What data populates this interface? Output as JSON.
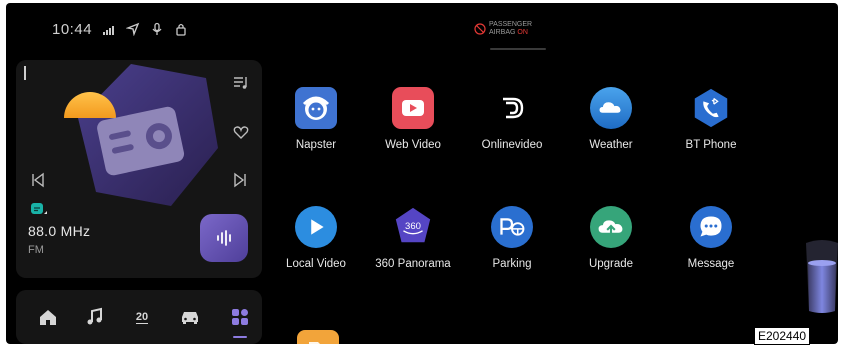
{
  "status_bar": {
    "time": "10:44",
    "icons": [
      "signal-icon",
      "navigation-icon",
      "microphone-icon",
      "lock-icon"
    ]
  },
  "airbag_indicator": {
    "line1": "PASSENGER",
    "line2_prefix": "AIRBAG",
    "line2_state": "ON",
    "state_color": "#e53935"
  },
  "media": {
    "frequency": "88.0 MHz",
    "band": "FM",
    "controls": [
      "playlist-icon",
      "favorite-icon",
      "previous-icon",
      "next-icon",
      "voice-wave-icon"
    ]
  },
  "dock": {
    "items": [
      "home-icon",
      "music-icon",
      "climate-temp",
      "car-icon",
      "apps-grid-icon"
    ],
    "temp": "20",
    "active_color": "#8d7be0"
  },
  "apps": [
    {
      "label": "Napster",
      "icon": "napster-icon",
      "color": "#3f73d1"
    },
    {
      "label": "Web Video",
      "icon": "web-video-icon",
      "color": "#e84d5a"
    },
    {
      "label": "Onlinevideo",
      "icon": "onlinevideo-icon",
      "color": "#000000"
    },
    {
      "label": "Weather",
      "icon": "weather-icon",
      "color": "#2f82d8"
    },
    {
      "label": "BT Phone",
      "icon": "bt-phone-icon",
      "color": "#2a6ed0"
    },
    {
      "label": "Local Video",
      "icon": "local-video-icon",
      "color": "#2c8de0"
    },
    {
      "label": "360 Panorama",
      "icon": "panorama-icon",
      "color": "#5545c4"
    },
    {
      "label": "Parking",
      "icon": "parking-icon",
      "color": "#2a6fd0"
    },
    {
      "label": "Upgrade",
      "icon": "upgrade-icon",
      "color": "#36a57a"
    },
    {
      "label": "Message",
      "icon": "message-icon",
      "color": "#2a6ed0"
    }
  ],
  "panorama_badge": "360",
  "reference_code": "E202440"
}
